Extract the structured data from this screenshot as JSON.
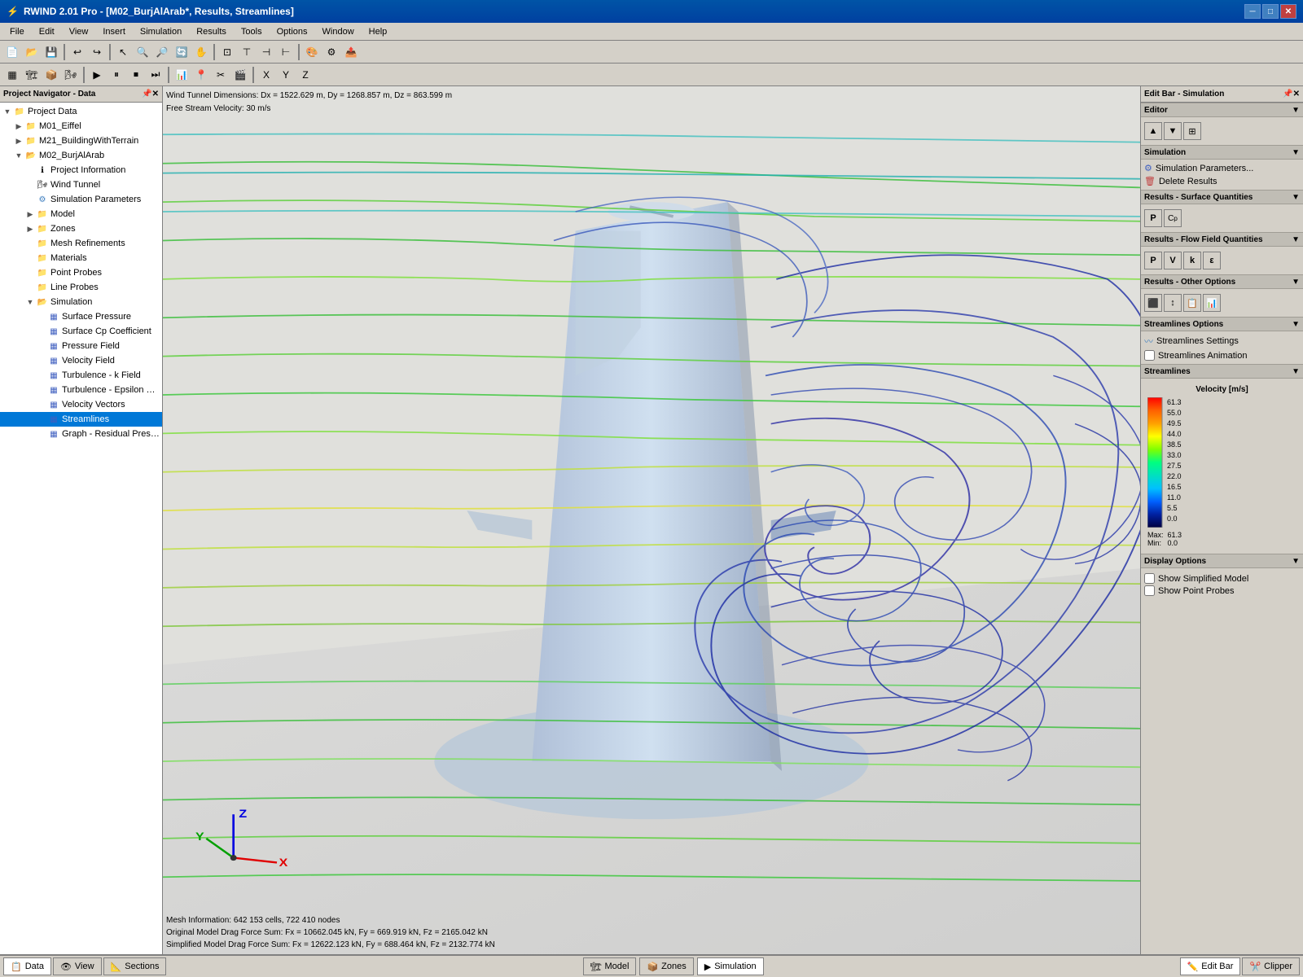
{
  "titleBar": {
    "title": "RWIND 2.01 Pro - [M02_BurjAlArab*, Results, Streamlines]",
    "iconSymbol": "⚡"
  },
  "menuBar": {
    "items": [
      "File",
      "Edit",
      "View",
      "Insert",
      "Simulation",
      "Results",
      "Tools",
      "Options",
      "Window",
      "Help"
    ]
  },
  "leftPanel": {
    "header": "Project Navigator - Data",
    "tree": [
      {
        "id": "project-data",
        "label": "Project Data",
        "indent": 0,
        "type": "folder",
        "expanded": true
      },
      {
        "id": "m01-eiffel",
        "label": "M01_Eiffel",
        "indent": 1,
        "type": "folder",
        "expanded": false
      },
      {
        "id": "m21-building",
        "label": "M21_BuildingWithTerrain",
        "indent": 1,
        "type": "folder",
        "expanded": false
      },
      {
        "id": "m02-burj",
        "label": "M02_BurjAlArab",
        "indent": 1,
        "type": "folder",
        "expanded": true
      },
      {
        "id": "project-info",
        "label": "Project Information",
        "indent": 2,
        "type": "info"
      },
      {
        "id": "wind-tunnel",
        "label": "Wind Tunnel",
        "indent": 2,
        "type": "info"
      },
      {
        "id": "sim-params",
        "label": "Simulation Parameters",
        "indent": 2,
        "type": "sim"
      },
      {
        "id": "model",
        "label": "Model",
        "indent": 2,
        "type": "folder"
      },
      {
        "id": "zones",
        "label": "Zones",
        "indent": 2,
        "type": "folder"
      },
      {
        "id": "mesh-refinements",
        "label": "Mesh Refinements",
        "indent": 2,
        "type": "folder"
      },
      {
        "id": "materials",
        "label": "Materials",
        "indent": 2,
        "type": "folder"
      },
      {
        "id": "point-probes",
        "label": "Point Probes",
        "indent": 2,
        "type": "folder"
      },
      {
        "id": "line-probes",
        "label": "Line Probes",
        "indent": 2,
        "type": "folder"
      },
      {
        "id": "simulation",
        "label": "Simulation",
        "indent": 2,
        "type": "folder",
        "expanded": true
      },
      {
        "id": "surface-pressure",
        "label": "Surface Pressure",
        "indent": 3,
        "type": "result"
      },
      {
        "id": "surface-cp",
        "label": "Surface Cp Coefficient",
        "indent": 3,
        "type": "result"
      },
      {
        "id": "pressure-field",
        "label": "Pressure Field",
        "indent": 3,
        "type": "result"
      },
      {
        "id": "velocity-field",
        "label": "Velocity Field",
        "indent": 3,
        "type": "result"
      },
      {
        "id": "turbulence-k",
        "label": "Turbulence - k Field",
        "indent": 3,
        "type": "result"
      },
      {
        "id": "turbulence-eps",
        "label": "Turbulence - Epsilon Field",
        "indent": 3,
        "type": "result"
      },
      {
        "id": "velocity-vectors",
        "label": "Velocity Vectors",
        "indent": 3,
        "type": "result"
      },
      {
        "id": "streamlines",
        "label": "Streamlines",
        "indent": 3,
        "type": "result",
        "selected": true
      },
      {
        "id": "graph-residual",
        "label": "Graph - Residual Pressure",
        "indent": 3,
        "type": "result"
      }
    ]
  },
  "viewport": {
    "infoTop": {
      "line1": "Wind Tunnel Dimensions: Dx = 1522.629 m, Dy = 1268.857 m, Dz = 863.599 m",
      "line2": "Free Stream Velocity: 30 m/s"
    },
    "infoBottom": {
      "line1": "Mesh Information: 642 153 cells, 722 410 nodes",
      "line2": "Original Model Drag Force Sum: Fx = 10662.045 kN, Fy = 669.919 kN, Fz = 2165.042 kN",
      "line3": "Simplified Model Drag Force Sum: Fx = 12622.123 kN, Fy = 688.464 kN, Fz = 2132.774 kN"
    }
  },
  "rightPanel": {
    "header": "Edit Bar - Simulation",
    "sections": {
      "editor": {
        "label": "Editor"
      },
      "simulation": {
        "label": "Simulation",
        "buttons": [
          "Simulation Parameters...",
          "Delete Results"
        ]
      },
      "surfaceQuantities": {
        "label": "Results - Surface Quantities",
        "buttons": [
          "P",
          "Cp"
        ]
      },
      "flowFieldQuantities": {
        "label": "Results - Flow Field Quantities",
        "buttons": [
          "P",
          "V",
          "k",
          "ε"
        ]
      },
      "otherOptions": {
        "label": "Results - Other Options",
        "buttons": [
          "icon1",
          "icon2",
          "icon3",
          "icon4"
        ]
      },
      "streamlinesOptions": {
        "label": "Streamlines Options",
        "items": [
          "Streamlines Settings",
          "Streamlines Animation"
        ]
      },
      "streamlines": {
        "label": "Streamlines",
        "legend": {
          "title": "Velocity [m/s]",
          "values": [
            "61.3",
            "55.0",
            "49.5",
            "44.0",
            "38.5",
            "33.0",
            "27.5",
            "22.0",
            "16.5",
            "11.0",
            "5.5",
            "0.0"
          ],
          "max": "61.3",
          "min": "0.0"
        }
      },
      "displayOptions": {
        "label": "Display Options",
        "checkboxes": [
          {
            "id": "show-simplified",
            "label": "Show Simplified Model",
            "checked": false
          },
          {
            "id": "show-point-probes",
            "label": "Show Point Probes",
            "checked": false
          }
        ]
      }
    }
  },
  "statusBar": {
    "left": {
      "tabs": [
        {
          "label": "Data",
          "icon": "📋"
        },
        {
          "label": "View",
          "icon": "👁"
        },
        {
          "label": "Sections",
          "icon": "📐"
        }
      ]
    },
    "right": {
      "tabs": [
        {
          "label": "Edit Bar",
          "icon": "✏️"
        },
        {
          "label": "Clipper",
          "icon": "✂️"
        }
      ]
    },
    "bottom": {
      "tabs": [
        {
          "label": "Model",
          "icon": "🏗"
        },
        {
          "label": "Zones",
          "icon": "📦"
        },
        {
          "label": "Simulation",
          "icon": "▶"
        }
      ]
    }
  }
}
